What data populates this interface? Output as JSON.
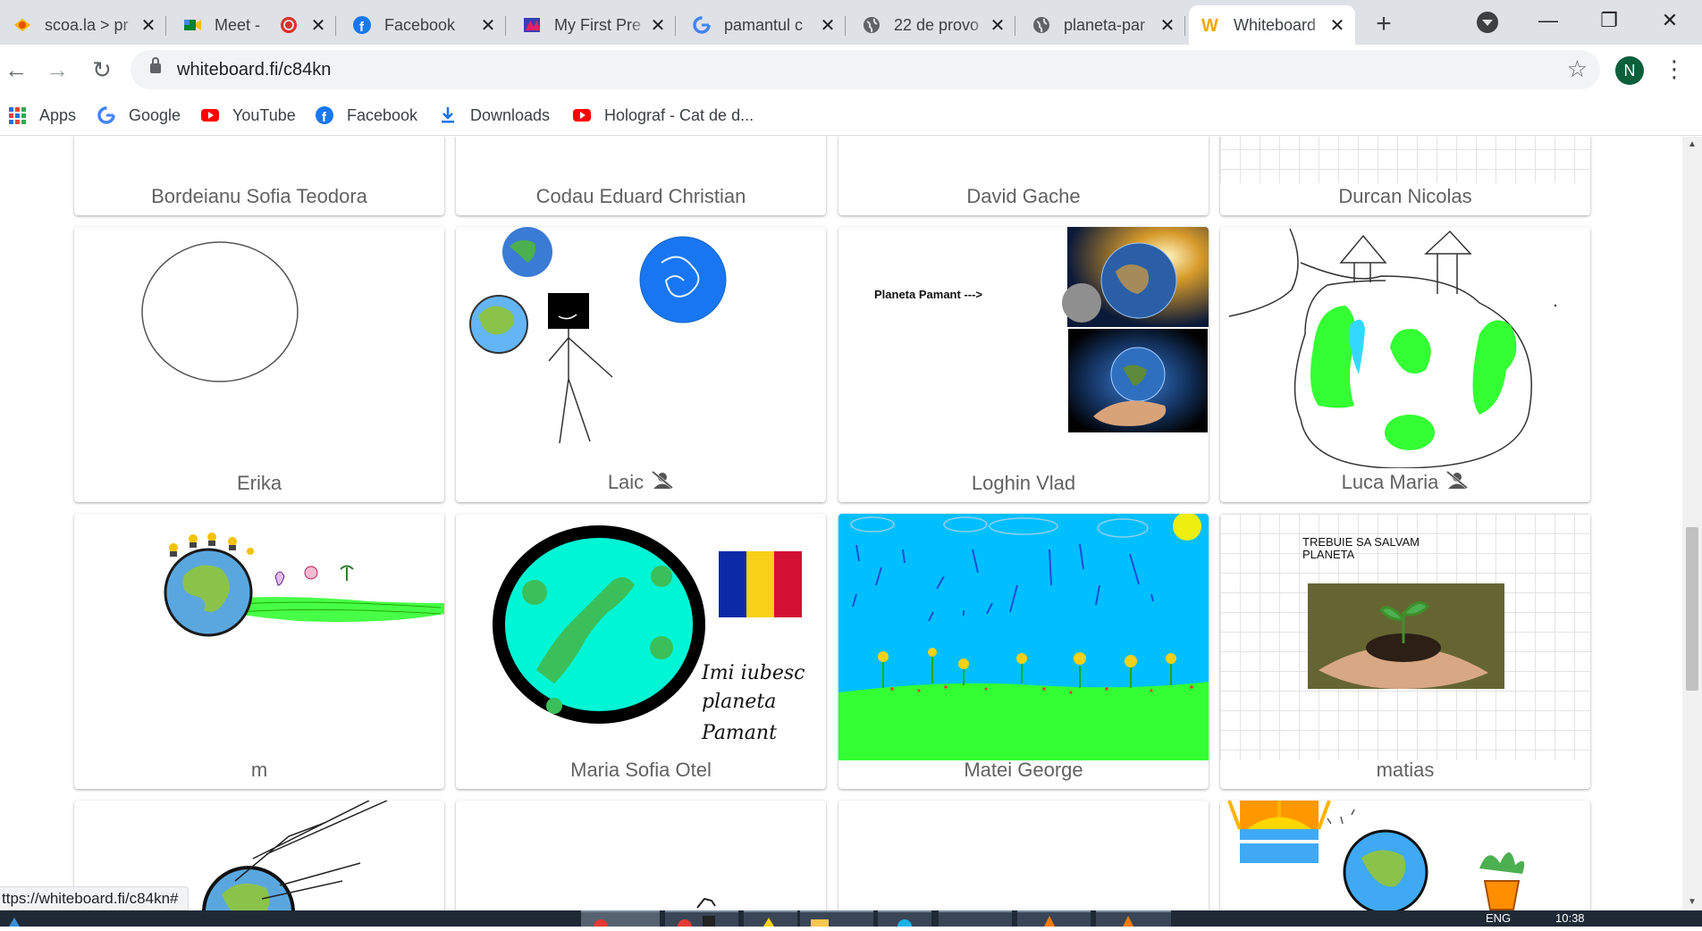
{
  "tabs": [
    {
      "title": "scoa.la > pr",
      "icon": "scoala-icon"
    },
    {
      "title": "Meet - ",
      "icon": "meet-icon",
      "recording": true
    },
    {
      "title": "Facebook",
      "icon": "facebook-icon"
    },
    {
      "title": "My First Pre",
      "icon": "presentation-icon"
    },
    {
      "title": "pamantul c",
      "icon": "google-icon"
    },
    {
      "title": "22 de provo",
      "icon": "globe-icon"
    },
    {
      "title": "planeta-par",
      "icon": "globe-icon"
    },
    {
      "title": "Whiteboard",
      "icon": "whiteboard-icon",
      "active": true
    }
  ],
  "address": {
    "url": "whiteboard.fi/c84kn"
  },
  "profile": {
    "initial": "N",
    "color": "#0b5f3a"
  },
  "bookmarks": [
    {
      "label": "Apps",
      "icon": "apps-grid-icon"
    },
    {
      "label": "Google",
      "icon": "google-icon"
    },
    {
      "label": "YouTube",
      "icon": "youtube-icon"
    },
    {
      "label": "Facebook",
      "icon": "facebook-icon"
    },
    {
      "label": "Downloads",
      "icon": "download-icon"
    },
    {
      "label": "Holograf - Cat de d...",
      "icon": "youtube-icon"
    }
  ],
  "boards": {
    "row1": [
      "Bordeianu Sofia Teodora",
      "Codau Eduard Christian",
      "David Gache",
      "Durcan Nicolas"
    ],
    "row2": [
      {
        "name": "Erika",
        "muted": false
      },
      {
        "name": "Laic",
        "muted": true
      },
      {
        "name": "Loghin Vlad",
        "muted": false,
        "text": "Planeta Pamant --->"
      },
      {
        "name": "Luca Maria",
        "muted": true
      }
    ],
    "row3": [
      {
        "name": "m"
      },
      {
        "name": "Maria Sofia Otel",
        "handwriting": [
          "Imi iubesc",
          "planeta",
          "Pamant"
        ]
      },
      {
        "name": "Matei George"
      },
      {
        "name": "matias",
        "text_line1": "TREBUIE SA SALVAM",
        "text_line2": "PLANETA"
      }
    ]
  },
  "status_url": "ttps://whiteboard.fi/c84kn#",
  "taskbar": {
    "lang": "ENG",
    "time": "10:38"
  },
  "colors": {
    "accent_green": "#33ff33",
    "sky_blue": "#00bfff",
    "globe_cyan": "#00f5d4"
  }
}
